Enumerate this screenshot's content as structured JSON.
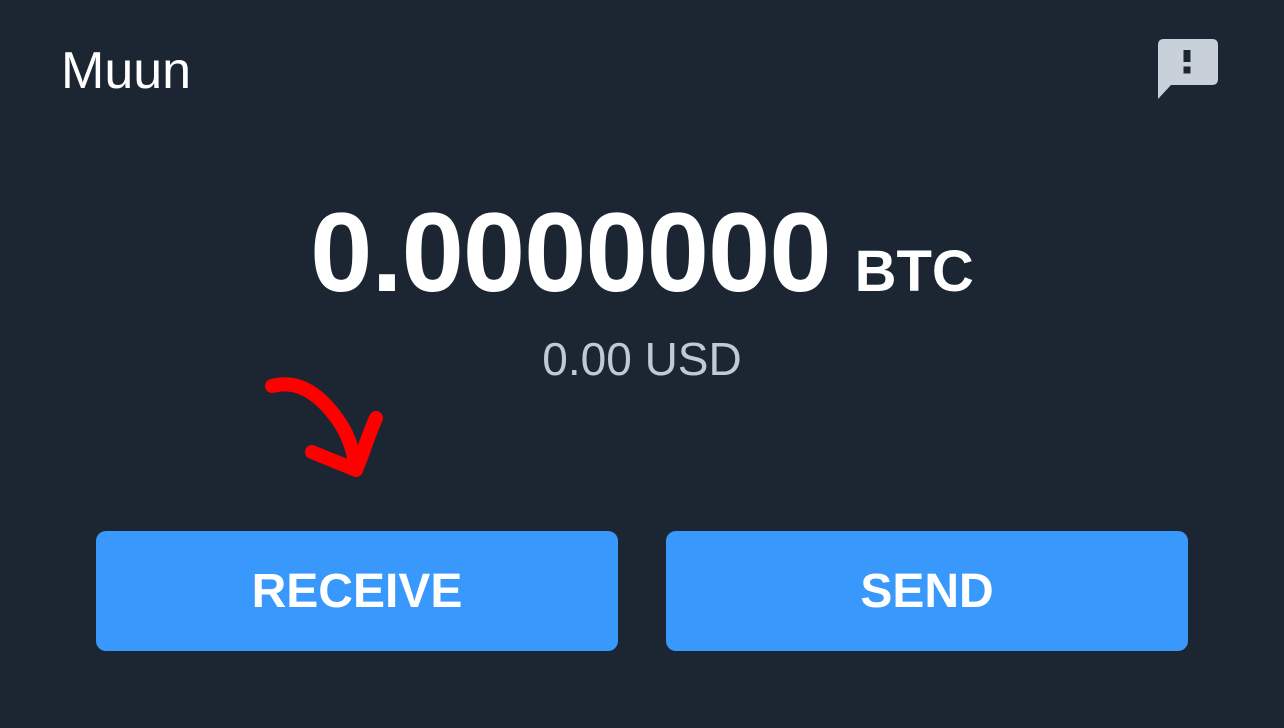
{
  "header": {
    "title": "Muun",
    "feedback_icon": "feedback-icon"
  },
  "balance": {
    "btc_amount": "0.0000000",
    "btc_unit": "BTC",
    "fiat": "0.00 USD"
  },
  "actions": {
    "receive_label": "RECEIVE",
    "send_label": "SEND"
  },
  "colors": {
    "background": "#1c2633",
    "button": "#3898fc",
    "fiat_text": "#c2c9d3",
    "feedback_icon": "#c8d0da",
    "annotation": "#ff0000"
  }
}
